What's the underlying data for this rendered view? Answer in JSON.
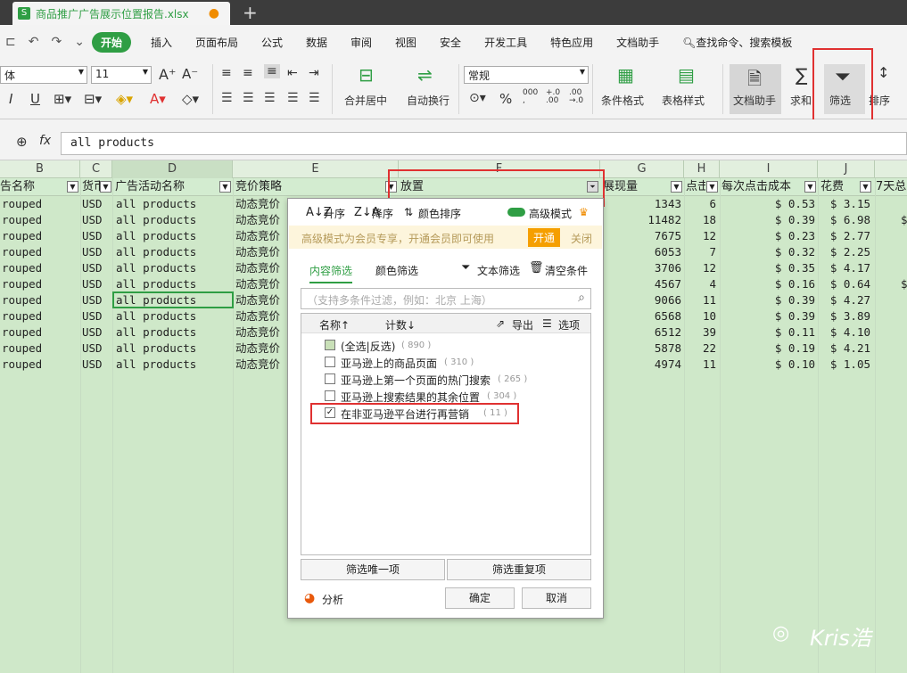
{
  "titlebar": {
    "filename": "商品推广广告展示位置报告.xlsx",
    "file_icon": "S",
    "new_tab": "+"
  },
  "menu": {
    "start": "开始",
    "items": [
      "插入",
      "页面布局",
      "公式",
      "数据",
      "审阅",
      "视图",
      "安全",
      "开发工具",
      "特色应用",
      "文档助手"
    ],
    "search": "查找命令、搜索模板"
  },
  "toolbar": {
    "font_name": "体",
    "font_size": "11",
    "number_format": "常规",
    "merge": "合并居中",
    "wrap": "自动换行",
    "cond_format": "条件格式",
    "table_style": "表格样式",
    "doc_helper": "文档助手",
    "sum": "求和",
    "filter": "筛选",
    "sort": "排序",
    "percent": "%",
    "sigma": "∑",
    "currency": "¥"
  },
  "formula": {
    "fx": "fx",
    "value": "all products"
  },
  "columns": [
    "B",
    "C",
    "D",
    "E",
    "F",
    "G",
    "H",
    "I",
    "J"
  ],
  "fields": [
    "告名称",
    "货币",
    "广告活动名称",
    "竞价策略",
    "放置",
    "展现量",
    "点击",
    "每次点击成本",
    "花费",
    "7天总"
  ],
  "rows": [
    [
      "rouped",
      "USD",
      "all products",
      "动态竞价",
      "1343",
      "6",
      "$ 0.53",
      "$ 3.15"
    ],
    [
      "rouped",
      "USD",
      "all products",
      "动态竞价",
      "11482",
      "18",
      "$ 0.39",
      "$ 6.98"
    ],
    [
      "rouped",
      "USD",
      "all products",
      "动态竞价",
      "7675",
      "12",
      "$ 0.23",
      "$ 2.77"
    ],
    [
      "rouped",
      "USD",
      "all products",
      "动态竞价",
      "6053",
      "7",
      "$ 0.32",
      "$ 2.25"
    ],
    [
      "rouped",
      "USD",
      "all products",
      "动态竞价",
      "3706",
      "12",
      "$ 0.35",
      "$ 4.17"
    ],
    [
      "rouped",
      "USD",
      "all products",
      "动态竞价",
      "4567",
      "4",
      "$ 0.16",
      "$ 0.64"
    ],
    [
      "rouped",
      "USD",
      "all products",
      "动态竞价",
      "9066",
      "11",
      "$ 0.39",
      "$ 4.27"
    ],
    [
      "rouped",
      "USD",
      "all products",
      "动态竞价",
      "6568",
      "10",
      "$ 0.39",
      "$ 3.89"
    ],
    [
      "rouped",
      "USD",
      "all products",
      "动态竞价",
      "6512",
      "39",
      "$ 0.11",
      "$ 4.10"
    ],
    [
      "rouped",
      "USD",
      "all products",
      "动态竞价",
      "5878",
      "22",
      "$ 0.19",
      "$ 4.21"
    ],
    [
      "rouped",
      "USD",
      "all products",
      "动态竞价",
      "4974",
      "11",
      "$ 0.10",
      "$ 1.05"
    ]
  ],
  "edge_dollar": "$",
  "popup": {
    "sort_asc": "升序",
    "sort_desc": "降序",
    "color_sort": "颜色排序",
    "advanced": "高级模式",
    "vip_msg": "高级模式为会员专享，开通会员即可使用",
    "vip_open": "开通",
    "vip_close": "关闭",
    "tab_content": "内容筛选",
    "tab_color": "颜色筛选",
    "text_filter": "文本筛选",
    "clear": "清空条件",
    "search_placeholder": "（支持多条件过滤，例如：北京 上海）",
    "col_name": "名称↑",
    "col_count": "计数↓",
    "export": "导出",
    "options": "选项",
    "items": [
      {
        "label": "(全选|反选)",
        "count": "( 890 )",
        "checked": false,
        "partial": true
      },
      {
        "label": "亚马逊上的商品页面",
        "count": "( 310 )",
        "checked": false
      },
      {
        "label": "亚马逊上第一个页面的热门搜索",
        "count": "( 265 )",
        "checked": false
      },
      {
        "label": "亚马逊上搜索结果的其余位置",
        "count": "( 304 )",
        "checked": false
      },
      {
        "label": "在非亚马逊平台进行再营销",
        "count": "( 11 )",
        "checked": true
      }
    ],
    "unique": "筛选唯一项",
    "dupes": "筛选重复项",
    "analysis": "分析",
    "ok": "确定",
    "cancel": "取消"
  },
  "watermark": "Kris浩",
  "colors": {
    "accent": "#2f9e44",
    "highlight": "#e03131",
    "grid_bg": "#cfe8c9"
  }
}
